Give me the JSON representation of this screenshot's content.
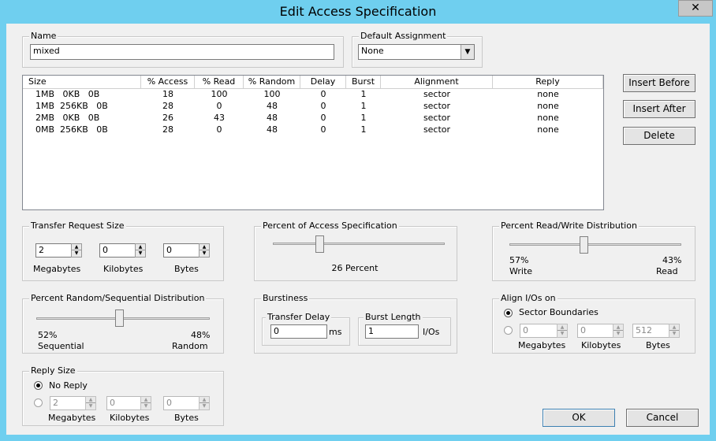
{
  "window": {
    "title": "Edit Access Specification",
    "close_glyph": "✕"
  },
  "name_group": {
    "label": "Name",
    "value": "mixed"
  },
  "default_assignment": {
    "label": "Default Assignment",
    "value": "None"
  },
  "list": {
    "columns": [
      "Size",
      "% Access",
      "% Read",
      "% Random",
      "Delay",
      "Burst",
      "Alignment",
      "Reply"
    ],
    "rows": [
      [
        "1MB   0KB   0B",
        "18",
        "100",
        "100",
        "0",
        "1",
        "sector",
        "none"
      ],
      [
        "1MB  256KB   0B",
        "28",
        "0",
        "48",
        "0",
        "1",
        "sector",
        "none"
      ],
      [
        "2MB   0KB   0B",
        "26",
        "43",
        "48",
        "0",
        "1",
        "sector",
        "none"
      ],
      [
        "0MB  256KB   0B",
        "28",
        "0",
        "48",
        "0",
        "1",
        "sector",
        "none"
      ]
    ]
  },
  "buttons": {
    "insert_before": "Insert Before",
    "insert_after": "Insert After",
    "delete": "Delete",
    "ok": "OK",
    "cancel": "Cancel"
  },
  "transfer": {
    "label": "Transfer Request Size",
    "mb": "2",
    "kb": "0",
    "b": "0",
    "mb_label": "Megabytes",
    "kb_label": "Kilobytes",
    "b_label": "Bytes"
  },
  "percent_access": {
    "label": "Percent of Access Specification",
    "value_text": "26 Percent",
    "level": 26
  },
  "read_write": {
    "label": "Percent Read/Write Distribution",
    "left_pct": "57%",
    "left_label": "Write",
    "right_pct": "43%",
    "right_label": "Read",
    "level": 43
  },
  "random_seq": {
    "label": "Percent Random/Sequential Distribution",
    "left_pct": "52%",
    "left_label": "Sequential",
    "right_pct": "48%",
    "right_label": "Random",
    "level": 48
  },
  "burstiness": {
    "label": "Burstiness",
    "delay_label": "Transfer Delay",
    "delay_value": "0",
    "delay_unit": "ms",
    "length_label": "Burst Length",
    "length_value": "1",
    "length_unit": "I/Os"
  },
  "align": {
    "label": "Align I/Os on",
    "sector_label": "Sector Boundaries",
    "mb": "0",
    "kb": "0",
    "b": "512",
    "mb_label": "Megabytes",
    "kb_label": "Kilobytes",
    "b_label": "Bytes"
  },
  "reply": {
    "label": "Reply Size",
    "no_reply_label": "No Reply",
    "mb": "2",
    "kb": "0",
    "b": "0",
    "mb_label": "Megabytes",
    "kb_label": "Kilobytes",
    "b_label": "Bytes"
  }
}
